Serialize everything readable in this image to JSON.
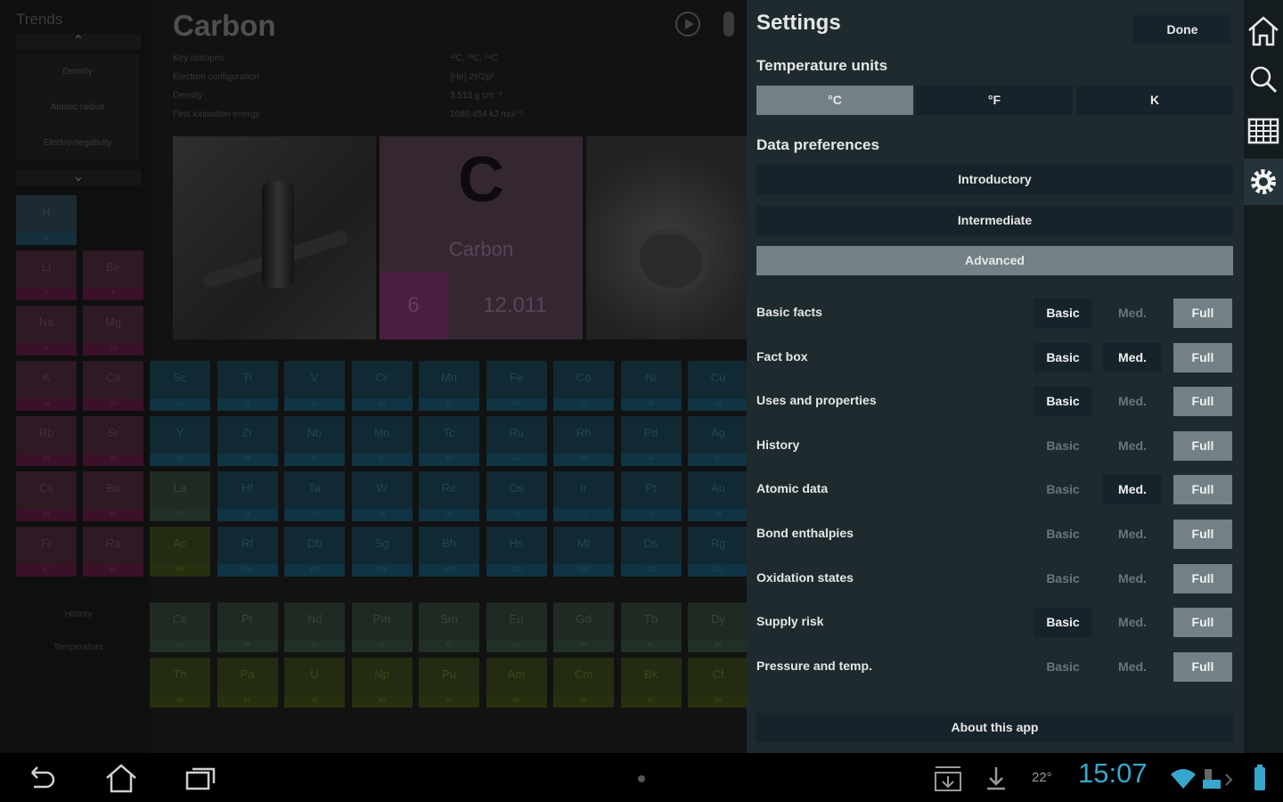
{
  "trends": {
    "title": "Trends",
    "items": [
      "Density",
      "Atomic radius",
      "Electro-negativity"
    ],
    "bottom": [
      "History",
      "Temperature"
    ]
  },
  "element": {
    "name": "Carbon",
    "symbol": "C",
    "atomic_number": "6",
    "atomic_mass": "12.011",
    "properties": [
      {
        "label": "Key isotopes",
        "value": "¹²C, ¹³C, ¹⁴C"
      },
      {
        "label": "Electron configuration",
        "value": "[He] 2s²2p²"
      },
      {
        "label": "Density",
        "value": "3.513 g cm⁻³"
      },
      {
        "label": "First ionisation energy",
        "value": "1086.454 kJ mol⁻¹"
      }
    ]
  },
  "periodic_table": {
    "s_block": [
      {
        "sym": "H",
        "num": "1"
      },
      {
        "sym": "Li",
        "num": "3"
      },
      {
        "sym": "Be",
        "num": "4"
      },
      {
        "sym": "Na",
        "num": "11"
      },
      {
        "sym": "Mg",
        "num": "12"
      },
      {
        "sym": "K",
        "num": "19"
      },
      {
        "sym": "Ca",
        "num": "20"
      },
      {
        "sym": "Rb",
        "num": "37"
      },
      {
        "sym": "Sr",
        "num": "38"
      },
      {
        "sym": "Cs",
        "num": "55"
      },
      {
        "sym": "Ba",
        "num": "56"
      },
      {
        "sym": "Fr",
        "num": "87"
      },
      {
        "sym": "Ra",
        "num": "88"
      }
    ],
    "d_rows": [
      [
        {
          "sym": "Sc",
          "num": "21"
        },
        {
          "sym": "Ti",
          "num": "22"
        },
        {
          "sym": "V",
          "num": "23"
        },
        {
          "sym": "Cr",
          "num": "24"
        },
        {
          "sym": "Mn",
          "num": "25"
        },
        {
          "sym": "Fe",
          "num": "26"
        },
        {
          "sym": "Co",
          "num": "27"
        },
        {
          "sym": "Ni",
          "num": "28"
        },
        {
          "sym": "Cu",
          "num": "29"
        }
      ],
      [
        {
          "sym": "Y",
          "num": "39"
        },
        {
          "sym": "Zr",
          "num": "40"
        },
        {
          "sym": "Nb",
          "num": "41"
        },
        {
          "sym": "Mo",
          "num": "42"
        },
        {
          "sym": "Tc",
          "num": "43"
        },
        {
          "sym": "Ru",
          "num": "44"
        },
        {
          "sym": "Rh",
          "num": "45"
        },
        {
          "sym": "Pd",
          "num": "46"
        },
        {
          "sym": "Ag",
          "num": "47"
        }
      ],
      [
        {
          "sym": "La",
          "num": "57"
        },
        {
          "sym": "Hf",
          "num": "72"
        },
        {
          "sym": "Ta",
          "num": "73"
        },
        {
          "sym": "W",
          "num": "74"
        },
        {
          "sym": "Re",
          "num": "75"
        },
        {
          "sym": "Os",
          "num": "76"
        },
        {
          "sym": "Ir",
          "num": "77"
        },
        {
          "sym": "Pt",
          "num": "78"
        },
        {
          "sym": "Au",
          "num": "79"
        }
      ],
      [
        {
          "sym": "Ac",
          "num": "89"
        },
        {
          "sym": "Rf",
          "num": "104"
        },
        {
          "sym": "Db",
          "num": "105"
        },
        {
          "sym": "Sg",
          "num": "106"
        },
        {
          "sym": "Bh",
          "num": "107"
        },
        {
          "sym": "Hs",
          "num": "108"
        },
        {
          "sym": "Mt",
          "num": "109"
        },
        {
          "sym": "Ds",
          "num": "110"
        },
        {
          "sym": "Rg",
          "num": "111"
        }
      ]
    ],
    "f_rows": [
      [
        {
          "sym": "Ce",
          "num": "58"
        },
        {
          "sym": "Pr",
          "num": "59"
        },
        {
          "sym": "Nd",
          "num": "60"
        },
        {
          "sym": "Pm",
          "num": "61"
        },
        {
          "sym": "Sm",
          "num": "62"
        },
        {
          "sym": "Eu",
          "num": "63"
        },
        {
          "sym": "Gd",
          "num": "64"
        },
        {
          "sym": "Tb",
          "num": "65"
        },
        {
          "sym": "Dy",
          "num": "66"
        }
      ],
      [
        {
          "sym": "Th",
          "num": "90"
        },
        {
          "sym": "Pa",
          "num": "91"
        },
        {
          "sym": "U",
          "num": "92"
        },
        {
          "sym": "Np",
          "num": "93"
        },
        {
          "sym": "Pu",
          "num": "94"
        },
        {
          "sym": "Am",
          "num": "95"
        },
        {
          "sym": "Cm",
          "num": "96"
        },
        {
          "sym": "Bk",
          "num": "97"
        },
        {
          "sym": "Cf",
          "num": "98"
        }
      ]
    ]
  },
  "settings": {
    "title": "Settings",
    "done_label": "Done",
    "temperature": {
      "title": "Temperature units",
      "options": [
        "°C",
        "°F",
        "K"
      ],
      "selected": "°C"
    },
    "data_prefs": {
      "title": "Data preferences",
      "options": [
        "Introductory",
        "Intermediate",
        "Advanced"
      ],
      "selected": "Advanced"
    },
    "level_labels": [
      "Basic",
      "Med.",
      "Full"
    ],
    "rows": [
      {
        "label": "Basic facts",
        "active": [
          "Basic"
        ]
      },
      {
        "label": "Fact box",
        "active": [
          "Basic",
          "Med."
        ]
      },
      {
        "label": "Uses and properties",
        "active": [
          "Basic"
        ]
      },
      {
        "label": "History",
        "active": []
      },
      {
        "label": "Atomic data",
        "active": [
          "Med."
        ]
      },
      {
        "label": "Bond enthalpies",
        "active": []
      },
      {
        "label": "Oxidation states",
        "active": []
      },
      {
        "label": "Supply risk",
        "active": [
          "Basic"
        ]
      },
      {
        "label": "Pressure and temp.",
        "active": []
      }
    ],
    "about_label": "About this app"
  },
  "sidenav": {
    "items": [
      "home-icon",
      "search-icon",
      "table-icon",
      "gear-icon"
    ],
    "selected": "gear-icon"
  },
  "status": {
    "time": "15:07",
    "temperature": "22°"
  },
  "colors": {
    "panel_bg": "#1e2a2e",
    "selected": "#738086",
    "clock": "#37a6cc"
  }
}
